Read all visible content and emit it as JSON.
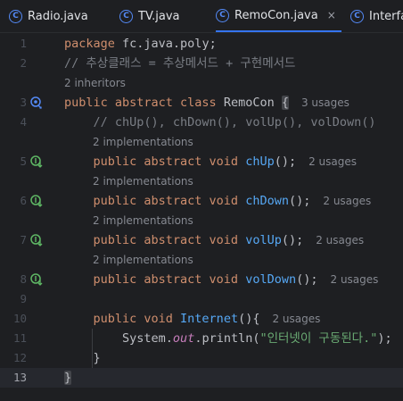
{
  "tabs": [
    {
      "label": "Radio.java",
      "icon": "C"
    },
    {
      "label": "TV.java",
      "icon": "C"
    },
    {
      "label": "RemoCon.java",
      "icon": "C",
      "active": true
    },
    {
      "label": "Interfa",
      "icon": "C"
    }
  ],
  "close_glyph": "×",
  "lines": [
    {
      "num": "1"
    },
    {
      "num": "2"
    },
    {
      "num": "3"
    },
    {
      "num": "4"
    },
    {
      "num": "5"
    },
    {
      "num": "6"
    },
    {
      "num": "7"
    },
    {
      "num": "8"
    },
    {
      "num": "9"
    },
    {
      "num": "10"
    },
    {
      "num": "11"
    },
    {
      "num": "12"
    },
    {
      "num": "13"
    }
  ],
  "code": {
    "l1_kw": "package",
    "l1_rest": " fc.java.poly;",
    "l2_comment": "// 추상클래스 = 추상메서드 + 구현메서드",
    "hint_inheritors": "2 inheritors",
    "l3_kw": "public abstract class",
    "l3_name": " RemoCon ",
    "l3_brace": "{",
    "l3_usage": "3 usages",
    "l4_comment": "    // chUp(), chDown(), volUp(), volDown()",
    "hint_impl": "2 implementations",
    "m_kw": "    public abstract void ",
    "m1_name": "chUp",
    "m2_name": "chDown",
    "m3_name": "volUp",
    "m4_name": "volDown",
    "m_tail": "();",
    "usage2": "2 usages",
    "l10_kw": "    public void ",
    "l10_name": "Internet",
    "l10_tail": "(){",
    "l11_a": "        System.",
    "l11_out": "out",
    "l11_b": ".println(",
    "l11_str": "\"인터넷이 구동된다.\"",
    "l11_c": ");",
    "l12": "    }",
    "l13": "}"
  },
  "colors": {
    "background": "#1e1f22",
    "keyword": "#cf8e6d",
    "method": "#56a8f5",
    "comment": "#7a7e85",
    "string": "#6aab73",
    "accent": "#3574f0"
  }
}
